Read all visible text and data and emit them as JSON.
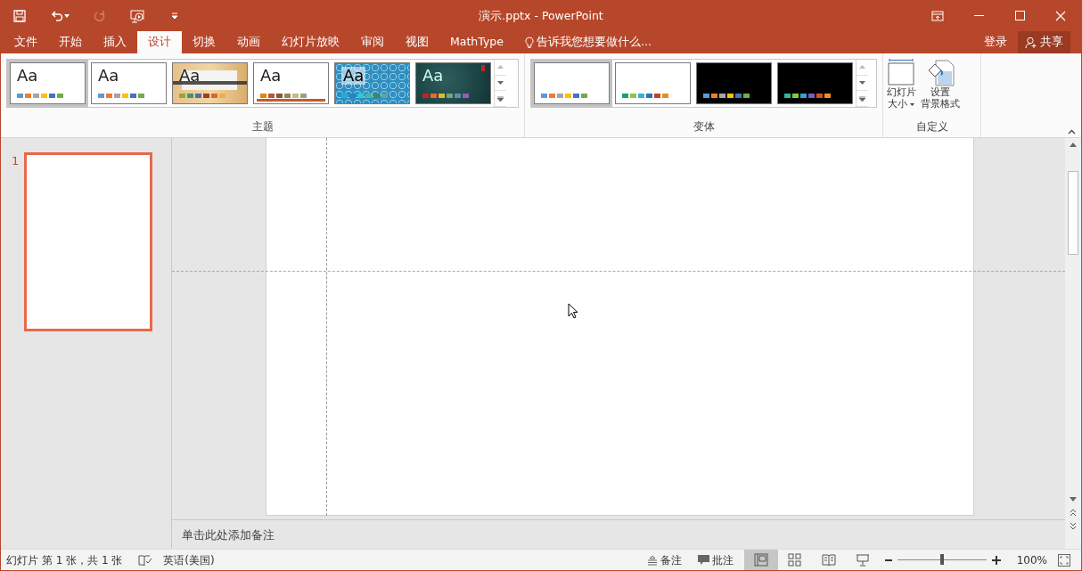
{
  "window": {
    "title": "演示.pptx - PowerPoint"
  },
  "quick_access": [
    {
      "kind": "save",
      "disabled": false
    },
    {
      "kind": "undo",
      "disabled": false
    },
    {
      "kind": "redo",
      "disabled": true
    },
    {
      "kind": "present",
      "disabled": false
    },
    {
      "kind": "customize",
      "disabled": false
    }
  ],
  "tabs": [
    {
      "label": "文件",
      "selected": false
    },
    {
      "label": "开始",
      "selected": false
    },
    {
      "label": "插入",
      "selected": false
    },
    {
      "label": "设计",
      "selected": true
    },
    {
      "label": "切换",
      "selected": false
    },
    {
      "label": "动画",
      "selected": false
    },
    {
      "label": "幻灯片放映",
      "selected": false
    },
    {
      "label": "审阅",
      "selected": false
    },
    {
      "label": "视图",
      "selected": false
    },
    {
      "label": "MathType",
      "selected": false
    }
  ],
  "tell_me": {
    "placeholder": "告诉我您想要做什么..."
  },
  "sign_in": "登录",
  "share": "共享",
  "themes": {
    "label": "主题",
    "items": [
      {
        "kind": "plain",
        "sample": "Aa",
        "selected": true,
        "swatches": [
          {
            "color": "#5b9bd5"
          },
          {
            "color": "#ed7d31"
          },
          {
            "color": "#a5a5a5"
          },
          {
            "color": "#ffc000"
          },
          {
            "color": "#4472c4"
          },
          {
            "color": "#70ad47"
          }
        ]
      },
      {
        "kind": "plain",
        "sample": "Aa",
        "selected": false,
        "swatches": [
          {
            "color": "#5b9bd5"
          },
          {
            "color": "#ed7d31"
          },
          {
            "color": "#a5a5a5"
          },
          {
            "color": "#ffc000"
          },
          {
            "color": "#4472c4"
          },
          {
            "color": "#70ad47"
          }
        ]
      },
      {
        "kind": "wood",
        "sample": "Aa",
        "selected": false,
        "swatches": [
          {
            "color": "#94a545"
          },
          {
            "color": "#3a9a77"
          },
          {
            "color": "#4e72a8"
          },
          {
            "color": "#a33a2c"
          },
          {
            "color": "#d9692a"
          },
          {
            "color": "#e8b33a"
          }
        ]
      },
      {
        "kind": "underline",
        "sample": "Aa",
        "selected": false,
        "swatches": [
          {
            "color": "#e48312"
          },
          {
            "color": "#bd582c"
          },
          {
            "color": "#865640"
          },
          {
            "color": "#9b8357"
          },
          {
            "color": "#c2bc80"
          },
          {
            "color": "#94a088"
          }
        ]
      },
      {
        "kind": "pattern",
        "sample": "Aa",
        "selected": false,
        "swatches": [
          {
            "color": "#1cade4"
          },
          {
            "color": "#2683c6"
          },
          {
            "color": "#27ced7"
          },
          {
            "color": "#42ba97"
          },
          {
            "color": "#3e8853"
          },
          {
            "color": "#62a39f"
          }
        ]
      },
      {
        "kind": "dark",
        "sample": "Aa",
        "selected": false,
        "swatches": [
          {
            "color": "#c0261f"
          },
          {
            "color": "#e66c27"
          },
          {
            "color": "#e5b434"
          },
          {
            "color": "#6fa77f"
          },
          {
            "color": "#5e8db1"
          },
          {
            "color": "#9c5bab"
          }
        ]
      }
    ]
  },
  "variants": {
    "label": "变体",
    "items": [
      {
        "kind": "light",
        "selected": true,
        "swatches": [
          {
            "color": "#5b9bd5"
          },
          {
            "color": "#ed7d31"
          },
          {
            "color": "#a5a5a5"
          },
          {
            "color": "#ffc000"
          },
          {
            "color": "#4472c4"
          },
          {
            "color": "#70ad47"
          }
        ]
      },
      {
        "kind": "light",
        "selected": false,
        "swatches": [
          {
            "color": "#1e9c7c"
          },
          {
            "color": "#8cc63f"
          },
          {
            "color": "#33b2d4"
          },
          {
            "color": "#2677b5"
          },
          {
            "color": "#c0461b"
          },
          {
            "color": "#e88c1f"
          }
        ]
      },
      {
        "kind": "dark",
        "selected": false,
        "swatches": [
          {
            "color": "#5b9bd5"
          },
          {
            "color": "#ed7d31"
          },
          {
            "color": "#a5a5a5"
          },
          {
            "color": "#ffc000"
          },
          {
            "color": "#4472c4"
          },
          {
            "color": "#70ad47"
          }
        ]
      },
      {
        "kind": "dark",
        "selected": false,
        "swatches": [
          {
            "color": "#2fb79f"
          },
          {
            "color": "#8cc63f"
          },
          {
            "color": "#33a3d4"
          },
          {
            "color": "#7b5bc4"
          },
          {
            "color": "#d2502f"
          },
          {
            "color": "#e8902a"
          }
        ]
      }
    ]
  },
  "customize": {
    "label": "自定义",
    "buttons": [
      {
        "kind": "slide_size",
        "lines": [
          "幻灯片",
          "大小"
        ]
      },
      {
        "kind": "format_background",
        "lines": [
          "设置",
          "背景格式"
        ]
      }
    ]
  },
  "slides": [
    {
      "number": "1",
      "selected": true
    }
  ],
  "notes": {
    "placeholder": "单击此处添加备注"
  },
  "status_bar": {
    "slide_info": "幻灯片 第 1 张，共 1 张",
    "language": "英语(美国)",
    "notes": "备注",
    "comments": "批注",
    "views": [
      {
        "kind": "normal",
        "selected": true
      },
      {
        "kind": "sorter",
        "selected": false
      },
      {
        "kind": "reading",
        "selected": false
      },
      {
        "kind": "slideshow",
        "selected": false
      }
    ],
    "zoom": {
      "level": 0.5
    },
    "zoom_reading": "100%"
  }
}
